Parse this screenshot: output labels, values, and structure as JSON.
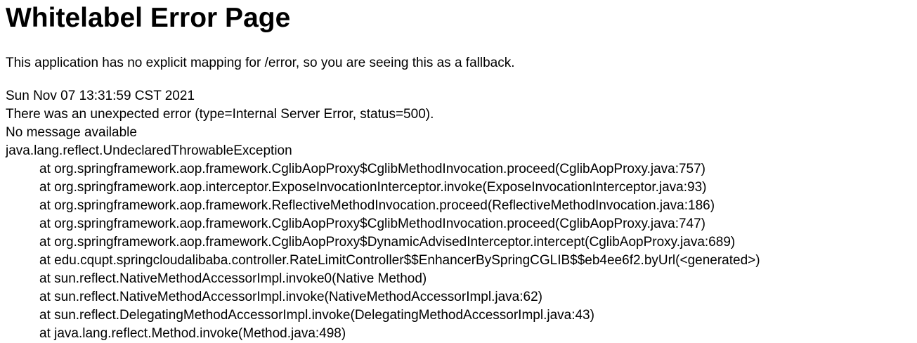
{
  "page": {
    "title": "Whitelabel Error Page",
    "subtitle": "This application has no explicit mapping for /error, so you are seeing this as a fallback."
  },
  "error": {
    "timestamp": "Sun Nov 07 13:31:59 CST 2021",
    "summary": "There was an unexpected error (type=Internal Server Error, status=500).",
    "message": "No message available",
    "exception": "java.lang.reflect.UndeclaredThrowableException",
    "stack_trace": [
      "at org.springframework.aop.framework.CglibAopProxy$CglibMethodInvocation.proceed(CglibAopProxy.java:757)",
      "at org.springframework.aop.interceptor.ExposeInvocationInterceptor.invoke(ExposeInvocationInterceptor.java:93)",
      "at org.springframework.aop.framework.ReflectiveMethodInvocation.proceed(ReflectiveMethodInvocation.java:186)",
      "at org.springframework.aop.framework.CglibAopProxy$CglibMethodInvocation.proceed(CglibAopProxy.java:747)",
      "at org.springframework.aop.framework.CglibAopProxy$DynamicAdvisedInterceptor.intercept(CglibAopProxy.java:689)",
      "at edu.cqupt.springcloudalibaba.controller.RateLimitController$$EnhancerBySpringCGLIB$$eb4ee6f2.byUrl(<generated>)",
      "at sun.reflect.NativeMethodAccessorImpl.invoke0(Native Method)",
      "at sun.reflect.NativeMethodAccessorImpl.invoke(NativeMethodAccessorImpl.java:62)",
      "at sun.reflect.DelegatingMethodAccessorImpl.invoke(DelegatingMethodAccessorImpl.java:43)",
      "at java.lang.reflect.Method.invoke(Method.java:498)"
    ]
  }
}
